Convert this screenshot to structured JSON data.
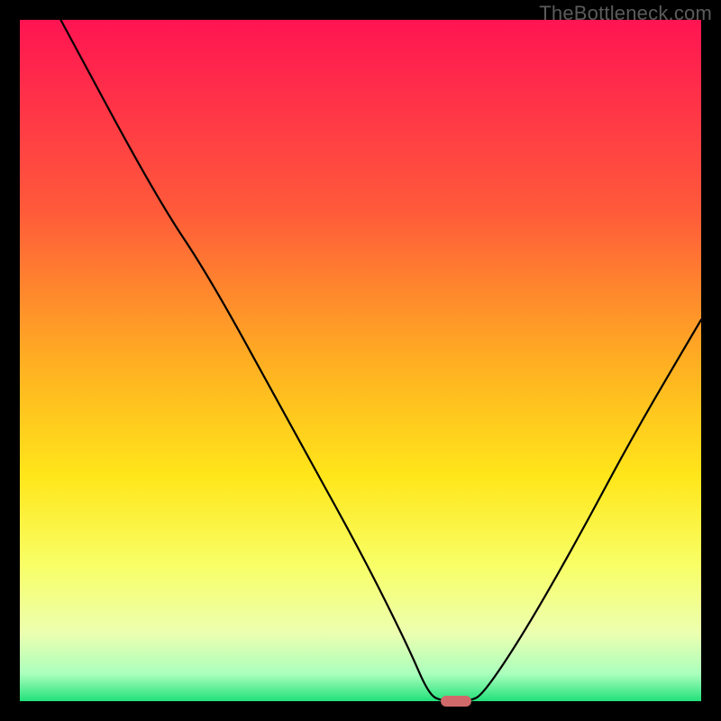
{
  "watermark": "TheBottleneck.com",
  "chart_data": {
    "type": "line",
    "title": "",
    "xlabel": "",
    "ylabel": "",
    "xlim": [
      0,
      100
    ],
    "ylim": [
      0,
      100
    ],
    "grid": false,
    "legend": false,
    "gradient_stops": [
      {
        "pct": 0,
        "color": "#ff1452"
      },
      {
        "pct": 28,
        "color": "#ff5a3a"
      },
      {
        "pct": 50,
        "color": "#ffae22"
      },
      {
        "pct": 67,
        "color": "#ffe61a"
      },
      {
        "pct": 80,
        "color": "#f8ff66"
      },
      {
        "pct": 90,
        "color": "#ecffb0"
      },
      {
        "pct": 96,
        "color": "#aaffbd"
      },
      {
        "pct": 100,
        "color": "#22e07a"
      }
    ],
    "series": [
      {
        "name": "bottleneck-curve",
        "stroke": "#000000",
        "stroke_width": 2.2,
        "points": [
          {
            "x": 6,
            "y": 100
          },
          {
            "x": 20,
            "y": 74
          },
          {
            "x": 28,
            "y": 62
          },
          {
            "x": 40,
            "y": 40
          },
          {
            "x": 50,
            "y": 22
          },
          {
            "x": 57,
            "y": 8
          },
          {
            "x": 60,
            "y": 1
          },
          {
            "x": 62,
            "y": 0
          },
          {
            "x": 66,
            "y": 0
          },
          {
            "x": 68,
            "y": 1
          },
          {
            "x": 74,
            "y": 10
          },
          {
            "x": 82,
            "y": 24
          },
          {
            "x": 90,
            "y": 39
          },
          {
            "x": 100,
            "y": 56
          }
        ]
      }
    ],
    "marker": {
      "name": "optimal-point",
      "x": 64,
      "y": 0,
      "width_pct": 4.5,
      "height_pct": 1.6,
      "color": "#d06a6a"
    }
  }
}
